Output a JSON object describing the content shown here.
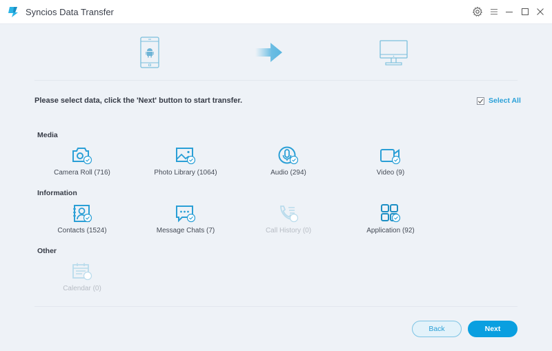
{
  "window": {
    "title": "Syncios Data Transfer",
    "controls": [
      "settings",
      "menu",
      "minimize",
      "maximize",
      "close"
    ]
  },
  "flow": {
    "source": "android-phone",
    "direction": "arrow-right",
    "target": "computer"
  },
  "instruction": "Please select data, click the 'Next' button to start transfer.",
  "select_all": {
    "label": "Select All",
    "checked": true
  },
  "sections": [
    {
      "label": "Media",
      "items": [
        {
          "label": "Camera Roll (716)",
          "icon": "camera-icon",
          "enabled": true,
          "checked": true
        },
        {
          "label": "Photo Library (1064)",
          "icon": "photo-icon",
          "enabled": true,
          "checked": true
        },
        {
          "label": "Audio (294)",
          "icon": "microphone-icon",
          "enabled": true,
          "checked": true
        },
        {
          "label": "Video (9)",
          "icon": "video-camera-icon",
          "enabled": true,
          "checked": true
        }
      ]
    },
    {
      "label": "Information",
      "items": [
        {
          "label": "Contacts (1524)",
          "icon": "contacts-icon",
          "enabled": true,
          "checked": true
        },
        {
          "label": "Message Chats (7)",
          "icon": "chat-bubble-icon",
          "enabled": true,
          "checked": true
        },
        {
          "label": "Call History (0)",
          "icon": "phone-call-icon",
          "enabled": false,
          "checked": false
        },
        {
          "label": "Application (92)",
          "icon": "apps-grid-icon",
          "enabled": true,
          "checked": true
        }
      ]
    },
    {
      "label": "Other",
      "items": [
        {
          "label": "Calendar (0)",
          "icon": "calendar-icon",
          "enabled": false,
          "checked": false
        }
      ]
    }
  ],
  "buttons": {
    "back": "Back",
    "next": "Next"
  },
  "colors": {
    "accent": "#0a9fe0",
    "icon": "#2a9fd6",
    "disabled_icon": "#b9dbec",
    "background": "#eef2f7"
  }
}
